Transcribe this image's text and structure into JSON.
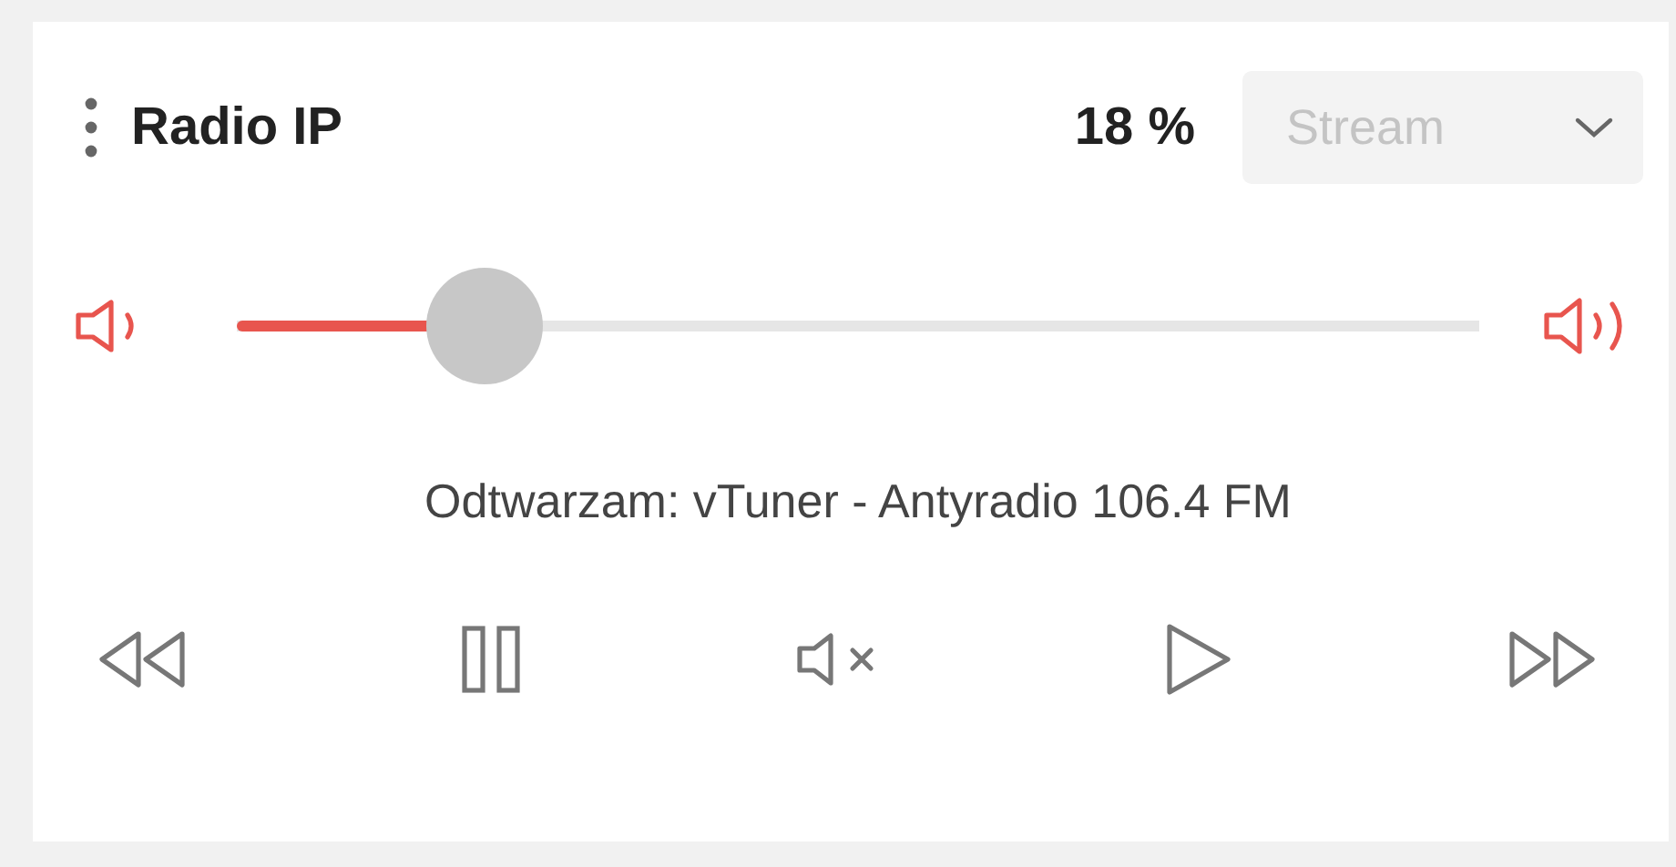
{
  "header": {
    "title": "Radio IP",
    "volume": "18 %"
  },
  "source_select": {
    "value": "Stream",
    "disabled": true
  },
  "volume_slider": {
    "level": 0.2
  },
  "now_playing": "Odtwarzam: vTuner - Antyradio 106.4 FM"
}
